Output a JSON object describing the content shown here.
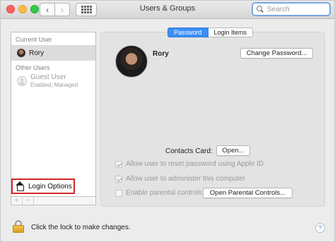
{
  "window": {
    "title": "Users & Groups"
  },
  "toolbar": {
    "back_glyph": "‹",
    "forward_glyph": "›"
  },
  "search": {
    "placeholder": "Search",
    "value": ""
  },
  "sidebar": {
    "current_user_heading": "Current User",
    "current_user": {
      "name": "Rory"
    },
    "other_users_heading": "Other Users",
    "guest": {
      "name": "Guest User",
      "status": "Enabled, Managed"
    },
    "login_options_label": "Login Options",
    "add_glyph": "+",
    "remove_glyph": "−"
  },
  "tabs": [
    {
      "label": "Password",
      "active": true
    },
    {
      "label": "Login Items",
      "active": false
    }
  ],
  "profile": {
    "name": "Rory",
    "change_password_label": "Change Password..."
  },
  "contacts": {
    "label": "Contacts Card:",
    "open_label": "Open..."
  },
  "options": {
    "reset_apple_id": {
      "label": "Allow user to reset password using Apple ID",
      "checked": true
    },
    "administer": {
      "label": "Allow user to administer this computer",
      "checked": true
    },
    "parental": {
      "label": "Enable parental controls",
      "checked": false
    },
    "open_parental_label": "Open Parental Controls..."
  },
  "footer": {
    "lock_text": "Click the lock to make changes.",
    "help_glyph": "?"
  },
  "colors": {
    "accent": "#3b8ef7",
    "highlight_border": "#d0282a",
    "lock": "#e3b03a"
  }
}
